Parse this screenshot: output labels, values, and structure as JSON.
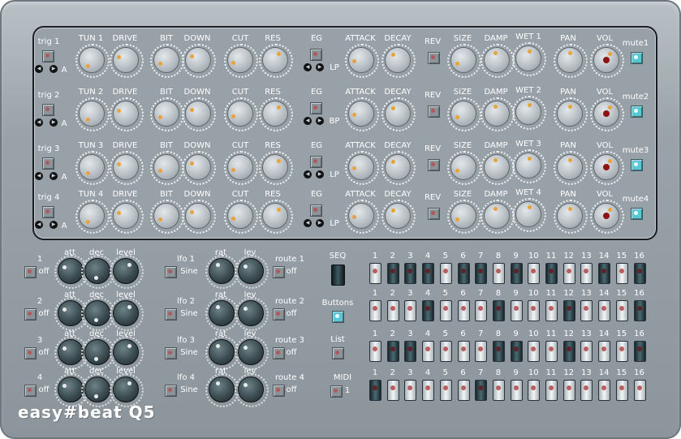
{
  "app_title": "easy#beat Q5",
  "voice_labels": {
    "tun": [
      "TUN 1",
      "TUN 2",
      "TUN 3",
      "TUN 4"
    ],
    "drive": "DRIVE",
    "bit": "BIT",
    "down": "DOWN",
    "cut": "CUT",
    "res": "RES",
    "eg": "EG",
    "attack": "ATTACK",
    "decay": "DECAY",
    "rev": "REV",
    "size": "SIZE",
    "damp": "DAMP",
    "wet": [
      "WET 1",
      "WET 2",
      "WET 3",
      "WET 4"
    ],
    "pan": "PAN",
    "vol": "VOL",
    "mute": [
      "mute1",
      "mute2",
      "mute3",
      "mute4"
    ],
    "trig": [
      "trig 1",
      "trig 2",
      "trig 3",
      "trig 4"
    ],
    "slot": "A",
    "filter": [
      "LP",
      "BP",
      "LP",
      "LP"
    ]
  },
  "env": {
    "state": "off",
    "labels": {
      "att": "att",
      "dec": "dec",
      "level": "level"
    },
    "ids": [
      "1",
      "2",
      "3",
      "4"
    ]
  },
  "lfo": {
    "names": [
      "lfo 1",
      "lfo 2",
      "lfo 3",
      "lfo 4"
    ],
    "wave": "Sine",
    "rat": "rat",
    "lev": "lev"
  },
  "route": {
    "names": [
      "route 1",
      "route 2",
      "route 3",
      "route 4"
    ],
    "state": "off"
  },
  "modes": {
    "seq": "SEQ",
    "buttons": "Buttons",
    "list": "List",
    "midi": "MIDI",
    "midi_channel": "1"
  },
  "sequencer": {
    "step_numbers": [
      "1",
      "2",
      "3",
      "4",
      "5",
      "6",
      "7",
      "8",
      "9",
      "10",
      "11",
      "12",
      "13",
      "14",
      "15",
      "16"
    ],
    "rows": [
      [
        1,
        0,
        0,
        0,
        1,
        0,
        0,
        1,
        0,
        1,
        0,
        1,
        1,
        0,
        1,
        0
      ],
      [
        1,
        1,
        1,
        0,
        1,
        1,
        1,
        0,
        1,
        1,
        1,
        0,
        1,
        1,
        1,
        0
      ],
      [
        1,
        0,
        0,
        1,
        1,
        1,
        1,
        0,
        0,
        1,
        1,
        0,
        1,
        1,
        1,
        0
      ],
      [
        0,
        1,
        1,
        1,
        1,
        1,
        0,
        1,
        1,
        1,
        1,
        1,
        1,
        1,
        1,
        1
      ]
    ]
  },
  "colors": {
    "panel": "#98a1a7",
    "knob_ring": "#eef1f3",
    "mute_button": "#59c8d6",
    "vol_core": "#8c1414"
  }
}
